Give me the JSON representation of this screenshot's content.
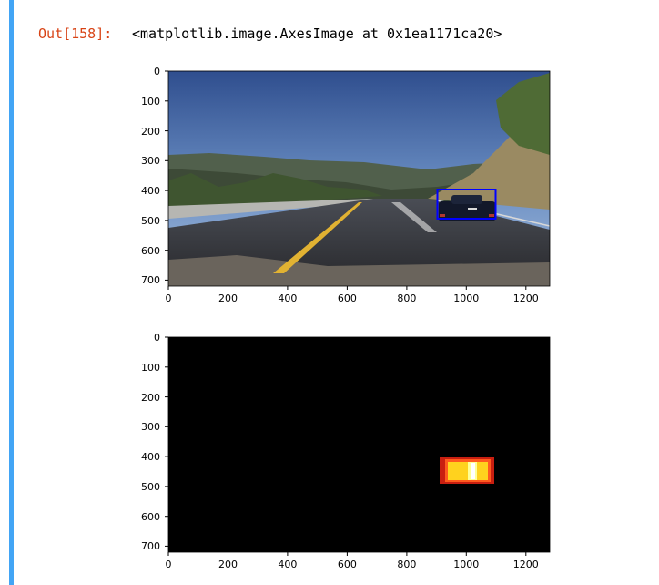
{
  "output_prompt": "Out[158]:",
  "output_repr": "<matplotlib.image.AxesImage at 0x1ea1171ca20>",
  "colors": {
    "cell_bar": "#42a5f5",
    "prompt": "#d84315"
  },
  "plots": [
    {
      "name": "road-image-plot",
      "type": "image",
      "xlim": [
        0,
        1280
      ],
      "ylim": [
        720,
        0
      ],
      "xticks": [
        "0",
        "200",
        "400",
        "600",
        "800",
        "1000",
        "1200"
      ],
      "yticks": [
        "0",
        "100",
        "200",
        "300",
        "400",
        "500",
        "600",
        "700"
      ],
      "bounding_box": {
        "x0": 900,
        "y0": 400,
        "x1": 1100,
        "y1": 495,
        "color": "#0000ff"
      }
    },
    {
      "name": "heatmap-plot",
      "type": "heatmap",
      "xlim": [
        0,
        1280
      ],
      "ylim": [
        720,
        0
      ],
      "xticks": [
        "0",
        "200",
        "400",
        "600",
        "800",
        "1000",
        "1200"
      ],
      "yticks": [
        "0",
        "100",
        "200",
        "300",
        "400",
        "500",
        "600",
        "700"
      ],
      "hot_region": {
        "x0": 900,
        "y0": 400,
        "x1": 1100,
        "y1": 495
      }
    }
  ]
}
